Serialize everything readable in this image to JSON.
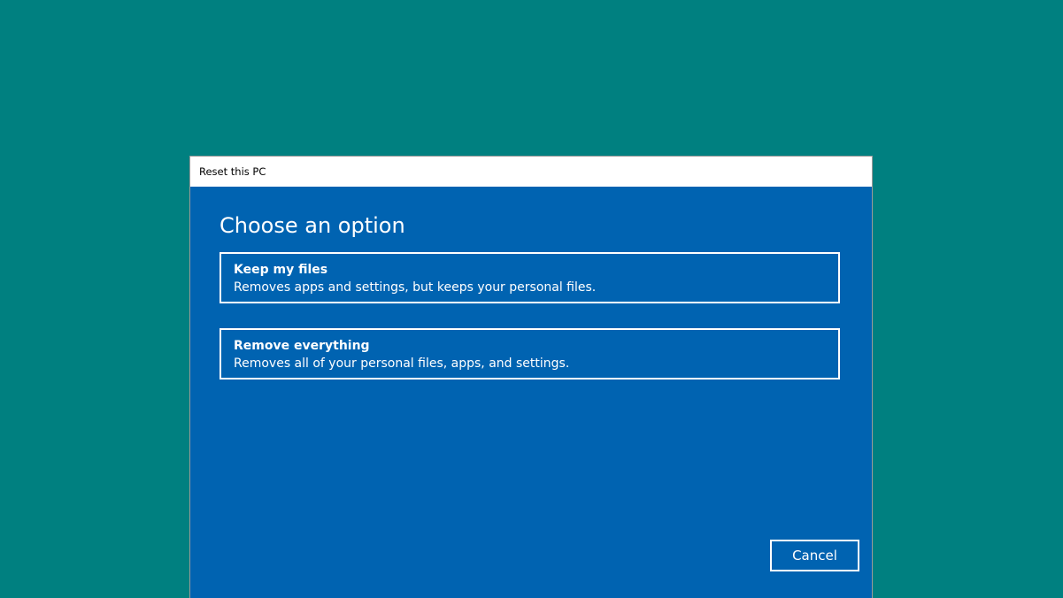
{
  "window": {
    "title": "Reset this PC"
  },
  "main": {
    "heading": "Choose an option",
    "options": [
      {
        "title": "Keep my files",
        "description": "Removes apps and settings, but keeps your personal files."
      },
      {
        "title": "Remove everything",
        "description": "Removes all of your personal files, apps, and settings."
      }
    ]
  },
  "footer": {
    "cancel_label": "Cancel"
  },
  "colors": {
    "desktop": "#008080",
    "dialog_background": "#0063b1",
    "titlebar": "#ffffff",
    "text": "#ffffff"
  }
}
